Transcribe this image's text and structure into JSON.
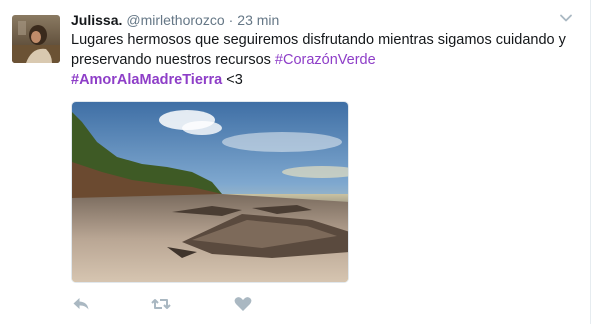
{
  "tweet": {
    "author_name": "Julissa.",
    "handle": "@mirlethorozco",
    "separator": "·",
    "time": "23 min",
    "text_main": "Lugares hermosos que seguiremos disfrutando mientras sigamos cuidando y preservando nuestros recursos ",
    "hashtag_1": "#CorazónVerde",
    "hashtag_2": "#AmorAlaMadreTierra",
    "text_tail": " <3"
  },
  "icons": {
    "caret": "chevron-down-icon",
    "reply": "reply-icon",
    "retweet": "retweet-icon",
    "like": "heart-icon"
  },
  "colors": {
    "hashtag": "#8e3ec8",
    "secondary_text": "#657786",
    "action_icon": "#aab8c2"
  }
}
